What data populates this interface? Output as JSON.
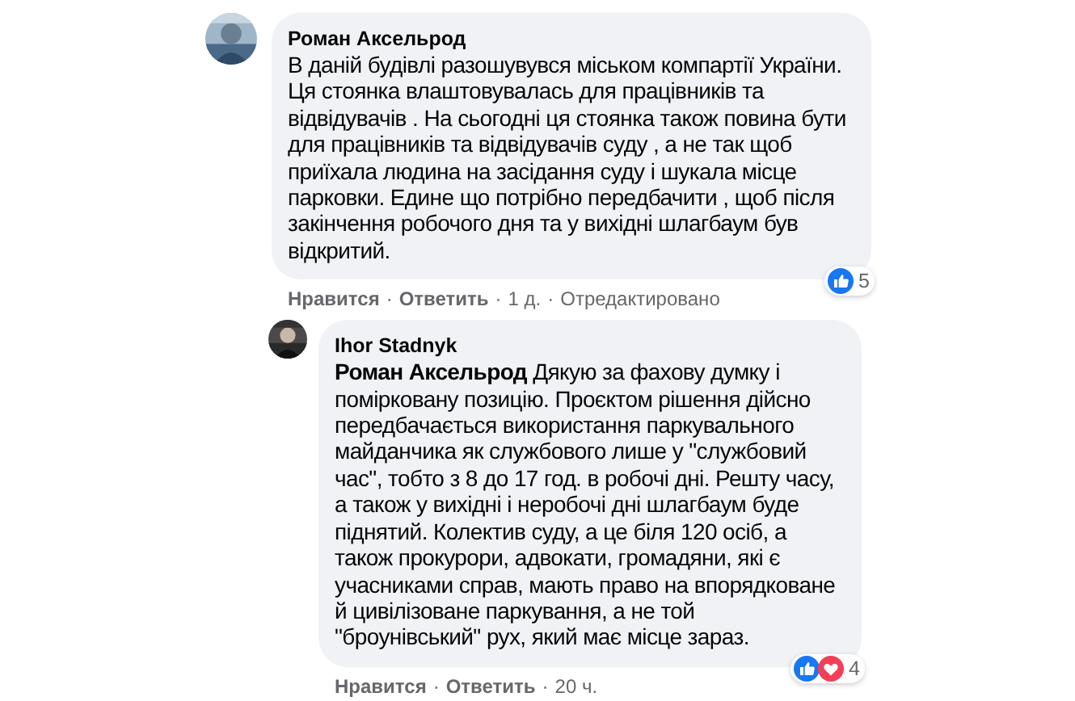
{
  "comments": [
    {
      "author": "Роман Аксельрод",
      "text": "В даній будівлі разошувувся міськом компартії України. Ця стоянка влаштовувалась для працівників та відвідувачів . На сьогодні ця стоянка також повина бути для працівників та відвідувачів суду , а не так щоб приїхала людина на засідання суду і шукала місце парковки. Едине що потрібно передбачити , щоб після закінчення робочого дня та у вихідні шлагбаум був відкритий.",
      "reply": false,
      "actions": [
        "Нравится",
        "Ответить"
      ],
      "meta": [
        "1 д.",
        "Отредактировано"
      ],
      "separator": "·",
      "reactions": [
        {
          "kind": "like"
        }
      ],
      "reaction_count": "5"
    },
    {
      "author": "Ihor Stadnyk",
      "text": "**Роман Аксельрод** Дякую за фахову думку і помірковану позицію. Проєктом рішення дійсно передбачається використання паркувального майданчика як службового лише у \"службовий час\", тобто з 8 до 17 год. в робочі дні. Решту часу, а також у вихідні і неробочі дні шлагбаум буде піднятий. Колектив суду, а це біля 120 осіб, а також прокурори, адвокати, громадяни, які є учасниками справ, мають право на впорядковане й цивілізоване паркування, а не той \"броунівський\" рух, який має місце зараз.",
      "reply": true,
      "actions": [
        "Нравится",
        "Ответить"
      ],
      "meta": [
        "20 ч."
      ],
      "separator": "·",
      "reactions": [
        {
          "kind": "like"
        },
        {
          "kind": "love"
        }
      ],
      "reaction_count": "4"
    }
  ]
}
